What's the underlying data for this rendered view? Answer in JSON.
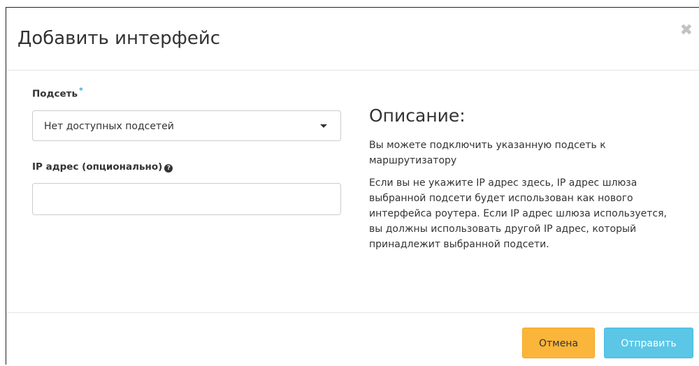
{
  "dialog": {
    "title": "Добавить интерфейс",
    "close_symbol": "✖"
  },
  "form": {
    "subnet": {
      "label": "Подсеть",
      "required_mark": "*",
      "selected_value": "Нет доступных подсетей"
    },
    "ip_address": {
      "label": "IP адрес (опционально)",
      "help_symbol": "?",
      "value": "",
      "placeholder": ""
    }
  },
  "description": {
    "title": "Описание:",
    "paragraph1": "Вы можете подключить указанную подсеть к маршрутизатору",
    "paragraph2": "Если вы не укажите IP адрес здесь, IP адрес шлюза выбранной подсети будет использован как нового интерфейса роутера. Если IP адрес шлюза используется, вы должны использовать другой IP адрес, который принадлежит выбранной подсети."
  },
  "footer": {
    "cancel_label": "Отмена",
    "submit_label": "Отправить"
  },
  "colors": {
    "cancel_button": "#fbb53a",
    "submit_button": "#5bc6e6",
    "required_star": "#3aa4d8"
  },
  "icons": {
    "close": "close-icon",
    "help": "question-circle-icon",
    "caret": "caret-down-icon"
  }
}
